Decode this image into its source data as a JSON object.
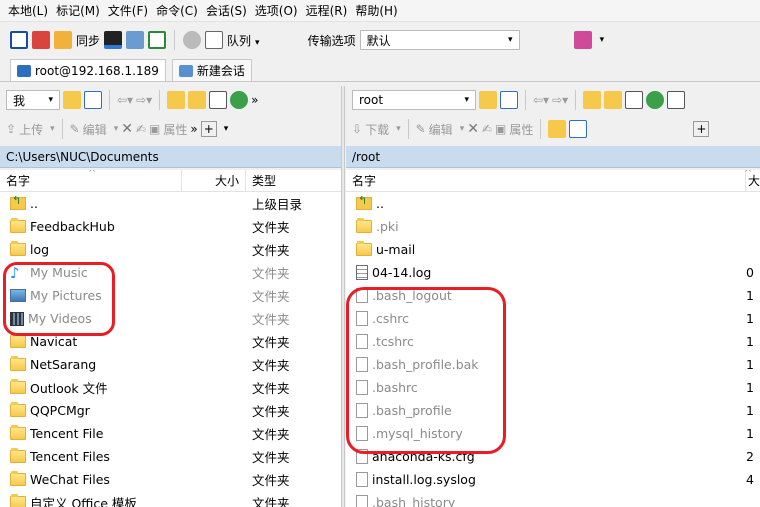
{
  "menubar": [
    "本地(L)",
    "标记(M)",
    "文件(F)",
    "命令(C)",
    "会话(S)",
    "选项(O)",
    "远程(R)",
    "帮助(H)"
  ],
  "toolbar": {
    "sync_label": "同步",
    "queue_label": "队列",
    "transfer_options_label": "传输选项",
    "transfer_options_value": "默认"
  },
  "tabs": [
    {
      "label": "root@192.168.1.189",
      "active": true
    },
    {
      "label": "新建会话",
      "active": false
    }
  ],
  "local": {
    "location_combo": "我",
    "actions": {
      "upload": "上传",
      "edit": "编辑",
      "properties": "属性"
    },
    "path": "C:\\Users\\NUC\\Documents",
    "columns": {
      "name": "名字",
      "size": "大小",
      "type": "类型"
    },
    "files": [
      {
        "name": "..",
        "type": "上级目录",
        "icon": "parent-dir-icon",
        "dim": false
      },
      {
        "name": "FeedbackHub",
        "type": "文件夹",
        "icon": "folder-icon",
        "dim": false
      },
      {
        "name": "log",
        "type": "文件夹",
        "icon": "folder-icon",
        "dim": false
      },
      {
        "name": "My Music",
        "type": "文件夹",
        "icon": "music-icon",
        "dim": true
      },
      {
        "name": "My Pictures",
        "type": "文件夹",
        "icon": "pictures-icon",
        "dim": true
      },
      {
        "name": "My Videos",
        "type": "文件夹",
        "icon": "videos-icon",
        "dim": true
      },
      {
        "name": "Navicat",
        "type": "文件夹",
        "icon": "folder-icon",
        "dim": false
      },
      {
        "name": "NetSarang",
        "type": "文件夹",
        "icon": "folder-icon",
        "dim": false
      },
      {
        "name": "Outlook 文件",
        "type": "文件夹",
        "icon": "folder-icon",
        "dim": false
      },
      {
        "name": "QQPCMgr",
        "type": "文件夹",
        "icon": "folder-icon",
        "dim": false
      },
      {
        "name": "Tencent File",
        "type": "文件夹",
        "icon": "folder-icon",
        "dim": false
      },
      {
        "name": "Tencent Files",
        "type": "文件夹",
        "icon": "folder-icon",
        "dim": false
      },
      {
        "name": "WeChat Files",
        "type": "文件夹",
        "icon": "folder-icon",
        "dim": false
      },
      {
        "name": "自定义 Office 模板",
        "type": "文件夹",
        "icon": "folder-icon",
        "dim": false
      }
    ]
  },
  "remote": {
    "location_combo": "root",
    "actions": {
      "download": "下载",
      "edit": "编辑",
      "properties": "属性"
    },
    "path": "/root",
    "columns": {
      "name": "名字",
      "size": "大"
    },
    "files": [
      {
        "name": "..",
        "size": "",
        "icon": "parent-dir-icon",
        "dim": false
      },
      {
        "name": ".pki",
        "size": "",
        "icon": "folder-icon",
        "dim": true
      },
      {
        "name": "u-mail",
        "size": "",
        "icon": "folder-icon",
        "dim": false
      },
      {
        "name": "04-14.log",
        "size": "0",
        "icon": "log-file-icon",
        "dim": false
      },
      {
        "name": ".bash_logout",
        "size": "1",
        "icon": "file-icon",
        "dim": true
      },
      {
        "name": ".cshrc",
        "size": "1",
        "icon": "file-icon",
        "dim": true
      },
      {
        "name": ".tcshrc",
        "size": "1",
        "icon": "file-icon",
        "dim": true
      },
      {
        "name": ".bash_profile.bak",
        "size": "1",
        "icon": "file-icon",
        "dim": true
      },
      {
        "name": ".bashrc",
        "size": "1",
        "icon": "file-icon",
        "dim": true
      },
      {
        "name": ".bash_profile",
        "size": "1",
        "icon": "file-icon",
        "dim": true
      },
      {
        "name": ".mysql_history",
        "size": "1",
        "icon": "file-icon",
        "dim": true
      },
      {
        "name": "anaconda-ks.cfg",
        "size": "2",
        "icon": "file-icon",
        "dim": false
      },
      {
        "name": "install.log.syslog",
        "size": "4",
        "icon": "file-icon",
        "dim": false
      },
      {
        "name": ".bash_history",
        "size": "",
        "icon": "file-icon",
        "dim": true
      }
    ]
  },
  "colors": {
    "highlight": "#e81d25",
    "pathbar": "#c9dcee",
    "dim_text": "#8a8a8a"
  }
}
